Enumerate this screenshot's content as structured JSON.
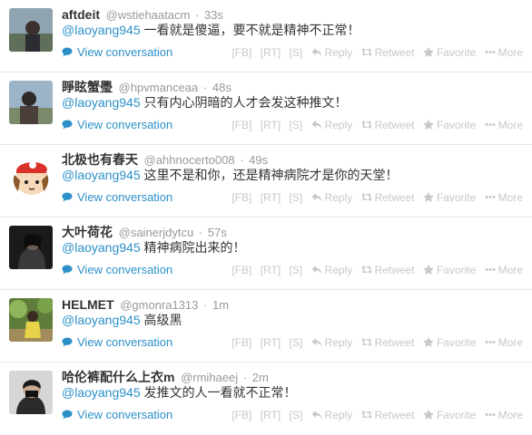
{
  "tweets": [
    {
      "name": "aftdeit",
      "handle": "@wstiehaatacm",
      "time": "33s",
      "mention": "@laoyang945",
      "text": " 一看就是傻逼，要不就是精神不正常！"
    },
    {
      "name": "睜眩蟹璺",
      "handle": "@hpvmanceaa",
      "time": "48s",
      "mention": "@laoyang945",
      "text": " 只有内心阴暗的人才会发这种推文！"
    },
    {
      "name": "北极也有春天",
      "handle": "@ahhnocerto008",
      "time": "49s",
      "mention": "@laoyang945",
      "text": " 这里不是和你，还是精神病院才是你的天堂！"
    },
    {
      "name": "大叶荷花",
      "handle": "@sainerjdytcu",
      "time": "57s",
      "mention": "@laoyang945",
      "text": " 精神病院出来的！"
    },
    {
      "name": "HELMET",
      "handle": "@gmonra1313",
      "time": "1m",
      "mention": "@laoyang945",
      "text": " 高级黑"
    },
    {
      "name": "哈伦裤配什么上衣m",
      "handle": "@rmihaeej",
      "time": "2m",
      "mention": "@laoyang945",
      "text": " 发推文的人一看就不正常！"
    }
  ],
  "labels": {
    "dot": "·",
    "view_conversation": "View conversation",
    "fb": "[FB]",
    "rt": "[RT]",
    "s": "[S]",
    "reply": "Reply",
    "retweet": "Retweet",
    "favorite": "Favorite",
    "more": "More"
  },
  "colors": {
    "link": "#2b90c8",
    "muted": "#999999",
    "action": "#c8c8c8"
  },
  "icons": {
    "view_conversation": "speech-bubble-icon",
    "reply": "reply-arrow-icon",
    "retweet": "retweet-icon",
    "favorite": "star-icon",
    "more": "more-dots-icon"
  }
}
